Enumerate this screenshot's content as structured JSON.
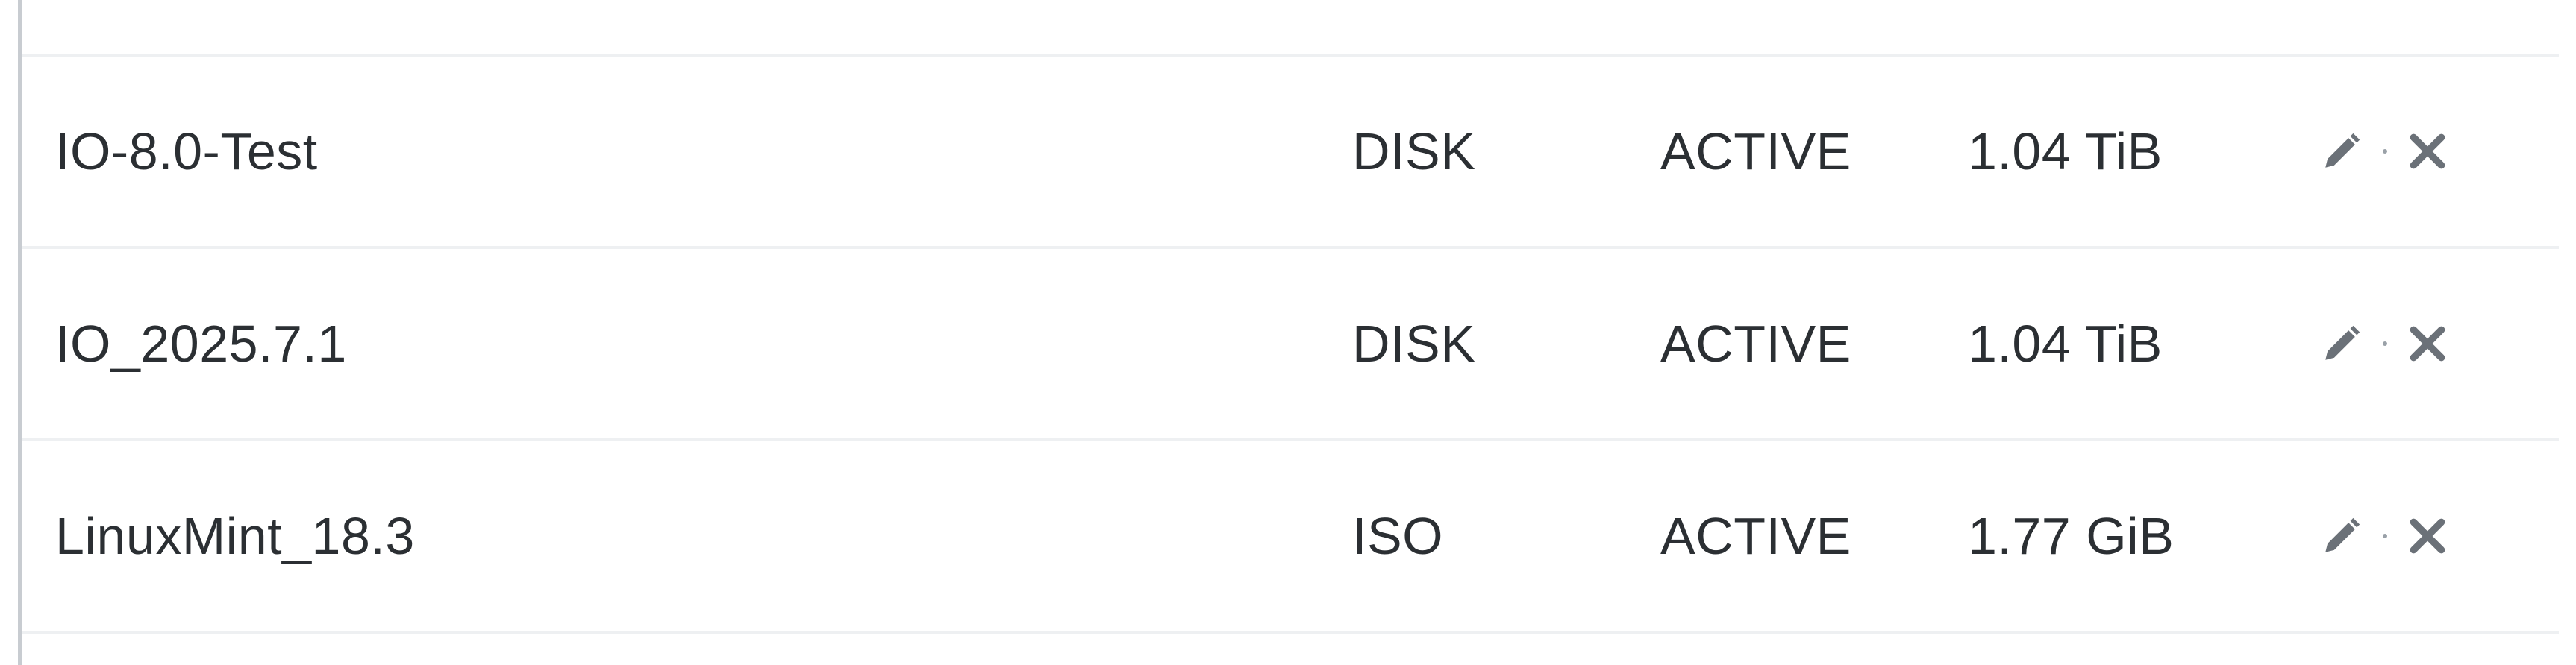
{
  "table": {
    "rows": [
      {
        "name": "IO-8.0-Test",
        "type": "DISK",
        "status": "ACTIVE",
        "size": "1.04 TiB"
      },
      {
        "name": "IO_2025.7.1",
        "type": "DISK",
        "status": "ACTIVE",
        "size": "1.04 TiB"
      },
      {
        "name": "LinuxMint_18.3",
        "type": "ISO",
        "status": "ACTIVE",
        "size": "1.77 GiB"
      }
    ],
    "actions": {
      "edit_icon": "pencil-icon",
      "delete_icon": "close-icon"
    }
  },
  "colors": {
    "text": "#2b2f33",
    "icon": "#6b7178",
    "divider": "#eef0f2",
    "left_border": "#c8ccd1"
  }
}
